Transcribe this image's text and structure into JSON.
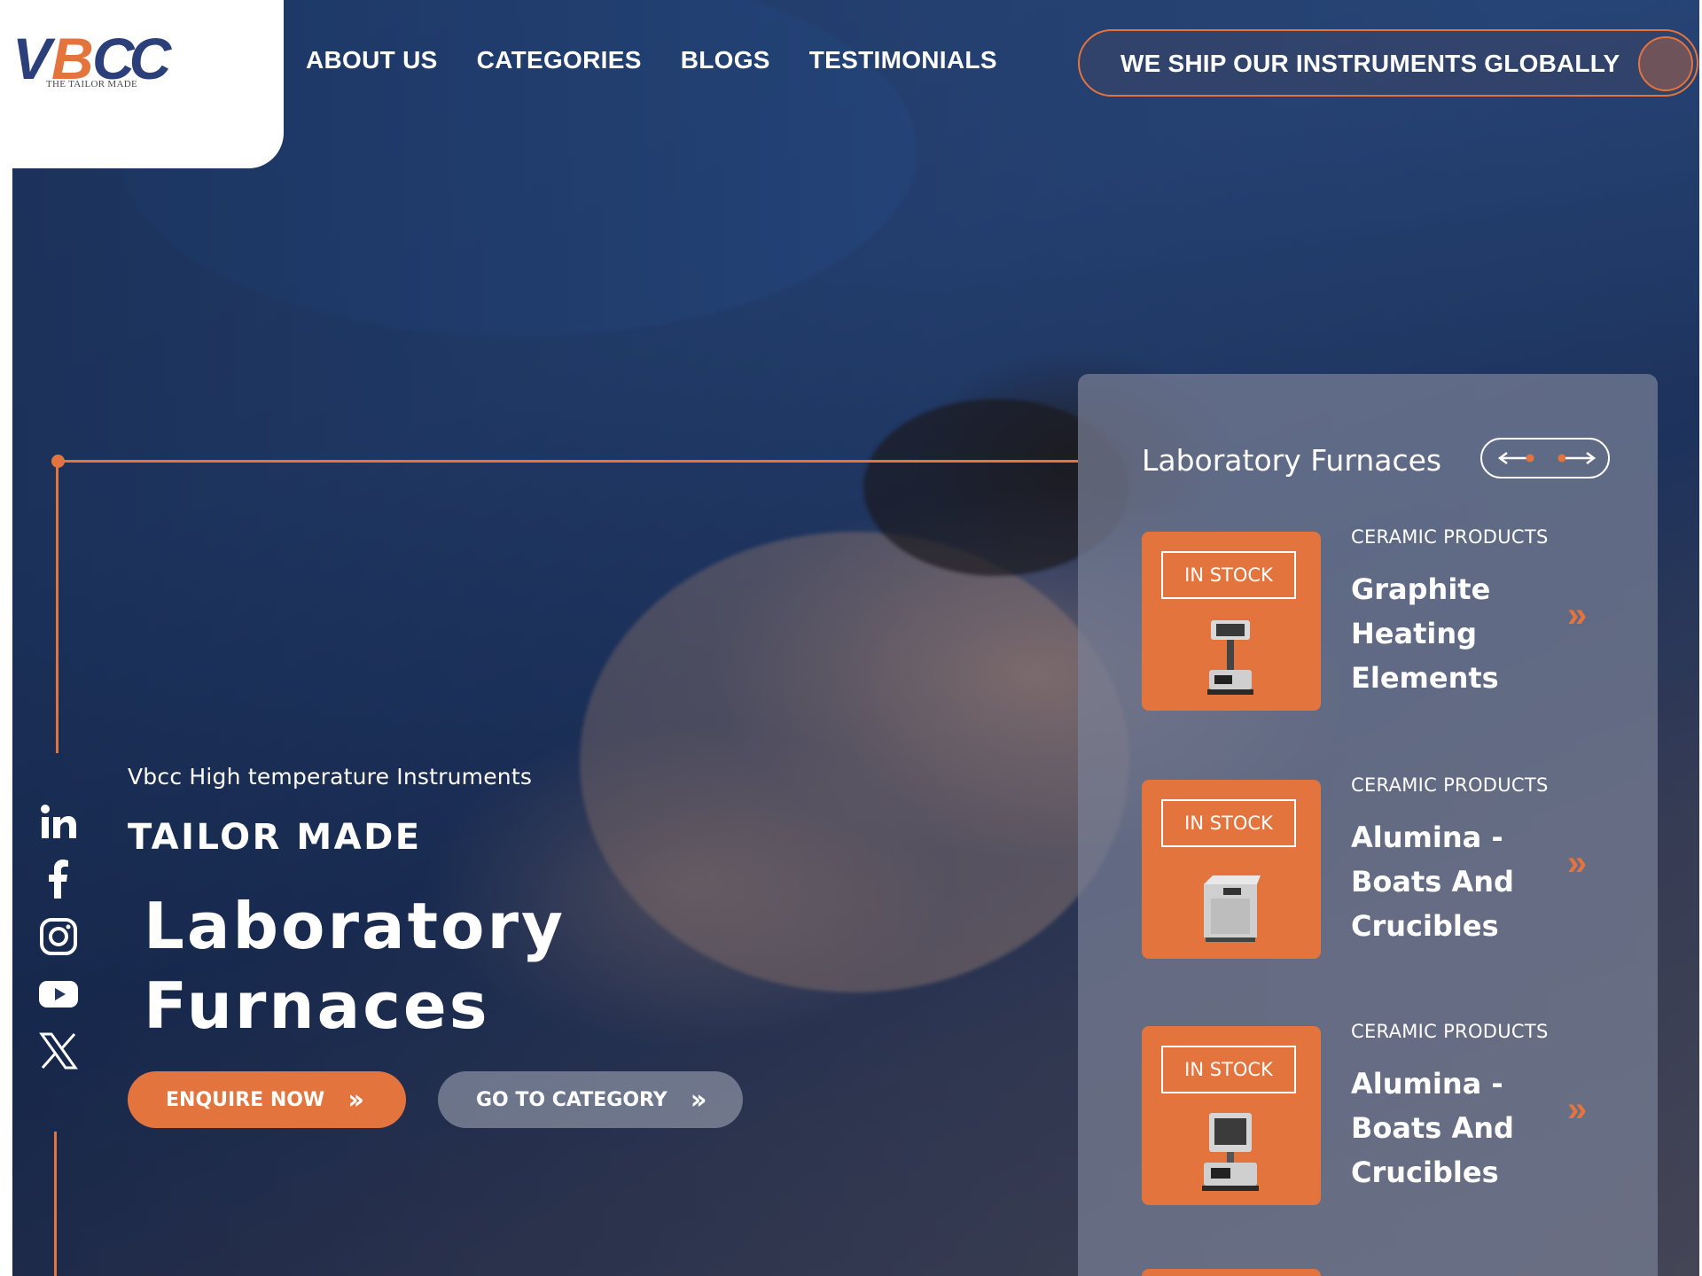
{
  "brand": {
    "name": "VBCC",
    "tagline": "THE TAILOR MADE",
    "accent": "#e3743e",
    "navy": "#2b3f7a"
  },
  "nav": {
    "items": [
      {
        "label": "ABOUT US"
      },
      {
        "label": "CATEGORIES"
      },
      {
        "label": "BLOGS"
      },
      {
        "label": "TESTIMONIALS"
      }
    ],
    "ship_label": "WE SHIP OUR INSTRUMENTS GLOBALLY"
  },
  "social": [
    "linkedin-icon",
    "facebook-icon",
    "instagram-icon",
    "youtube-icon",
    "x-icon"
  ],
  "hero": {
    "subtitle": "Vbcc High temperature Instruments",
    "kicker": "TAILOR MADE",
    "title_line1": "Laboratory",
    "title_line2": "Furnaces",
    "enquire_label": "ENQUIRE NOW",
    "category_label": "GO TO CATEGORY"
  },
  "panel": {
    "title": "Laboratory Furnaces",
    "products": [
      {
        "badge": "IN STOCK",
        "category": "CERAMIC PRODUCTS",
        "name": "Graphite Heating Elements"
      },
      {
        "badge": "IN STOCK",
        "category": "CERAMIC PRODUCTS",
        "name": "Alumina - Boats And Crucibles"
      },
      {
        "badge": "IN STOCK",
        "category": "CERAMIC PRODUCTS",
        "name": "Alumina - Boats And Crucibles"
      }
    ]
  }
}
